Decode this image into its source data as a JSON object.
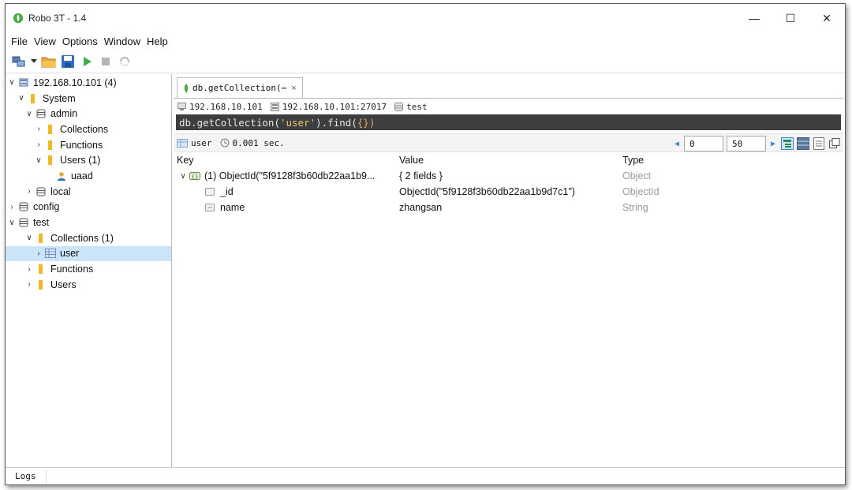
{
  "window": {
    "title": "Robo 3T - 1.4",
    "minimize_glyph": "—",
    "maximize_glyph": "☐",
    "close_glyph": "✕"
  },
  "menu": [
    "File",
    "View",
    "Options",
    "Window",
    "Help"
  ],
  "toolbar": {
    "icons": [
      "connect-icon",
      "dropdown-arrow-icon",
      "open-folder-icon",
      "save-icon",
      "run-icon",
      "stop-icon",
      "rotate-icon"
    ]
  },
  "explorer": {
    "server": "192.168.10.101 (4)",
    "system": "System",
    "admin": "admin",
    "admin_collections": "Collections",
    "admin_functions": "Functions",
    "admin_users": "Users (1)",
    "admin_user_uaad": "uaad",
    "local": "local",
    "config": "config",
    "test": "test",
    "test_collections": "Collections (1)",
    "test_user": "user",
    "test_functions": "Functions",
    "test_users": "Users"
  },
  "tab": {
    "label": "db.getCollection(⋯",
    "close": "×"
  },
  "connection": {
    "host": "192.168.10.101",
    "address": "192.168.10.101:27017",
    "database": "test"
  },
  "query": {
    "prefix": "db.getCollection(",
    "string": "'user'",
    "mid": ").find(",
    "parens": "{}",
    "suffix": ")"
  },
  "result": {
    "collection": "user",
    "time": "0.001 sec.",
    "skip": "0",
    "limit": "50"
  },
  "grid": {
    "headers": {
      "key": "Key",
      "value": "Value",
      "type": "Type"
    },
    "rows": [
      {
        "key": "(1) ObjectId(\"5f9128f3b60db22aa1b9...",
        "value": "{ 2 fields }",
        "type": "Object"
      },
      {
        "key": "_id",
        "value": "ObjectId(\"5f9128f3b60db22aa1b9d7c1\")",
        "type": "ObjectId"
      },
      {
        "key": "name",
        "value": "zhangsan",
        "type": "String"
      }
    ]
  },
  "status": {
    "logs": "Logs"
  },
  "colors": {
    "selection": "#cce4f7",
    "editor_bg": "#3d3e3f",
    "folder": "#f2b824",
    "accent": "#3a86d6",
    "mongo_green": "#4fa94d"
  }
}
